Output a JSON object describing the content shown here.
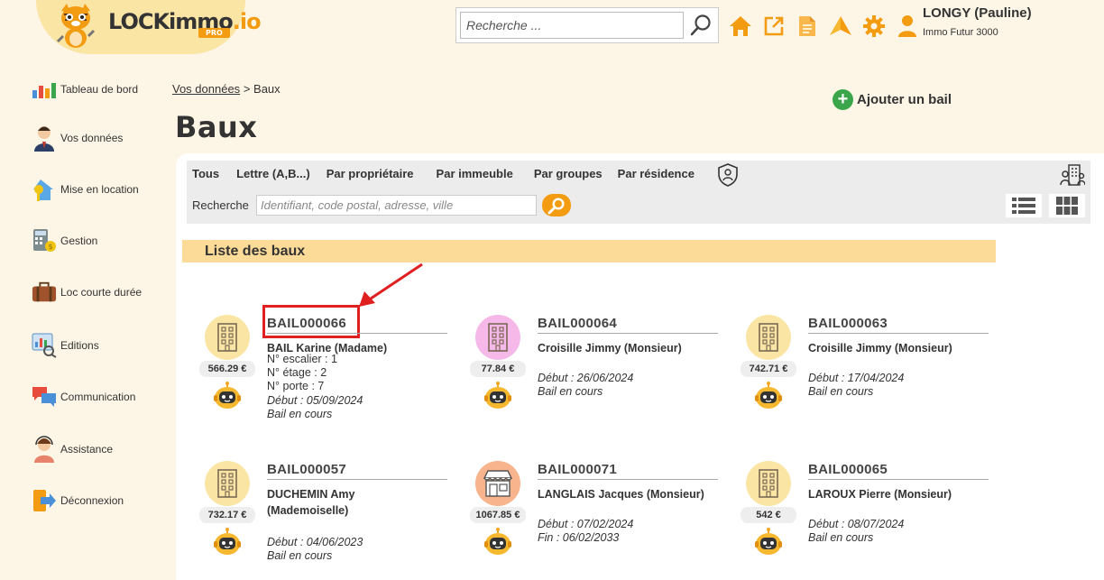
{
  "app": {
    "logo_text": "LOCKimmo",
    "logo_suffix": ".io",
    "logo_badge": "PRO",
    "colors": {
      "accent": "#f39c12",
      "brand_bg": "#fbe5a5",
      "section_header": "#fbdb97",
      "highlight": "#e02020"
    }
  },
  "search": {
    "placeholder": "Recherche ..."
  },
  "user": {
    "name": "LONGY (Pauline)",
    "agency": "Immo Futur 3000"
  },
  "top_icons": [
    "home-icon",
    "external-link-icon",
    "document-icon",
    "paper-plane-icon",
    "settings-icon",
    "user-icon"
  ],
  "sidebar": {
    "items": [
      {
        "label": "Tableau de bord",
        "icon": "dashboard-icon"
      },
      {
        "label": "Vos données",
        "icon": "user-data-icon"
      },
      {
        "label": "Mise en location",
        "icon": "house-key-icon"
      },
      {
        "label": "Gestion",
        "icon": "calculator-icon"
      },
      {
        "label": "Loc courte durée",
        "icon": "suitcase-icon"
      },
      {
        "label": "Editions",
        "icon": "editions-icon"
      },
      {
        "label": "Communication",
        "icon": "chat-icon"
      },
      {
        "label": "Assistance",
        "icon": "support-icon"
      },
      {
        "label": "Déconnexion",
        "icon": "logout-icon"
      }
    ]
  },
  "breadcrumb": {
    "parent": "Vos données",
    "separator": ">",
    "current": "Baux"
  },
  "page": {
    "title": "Baux",
    "add_button": "Ajouter un bail"
  },
  "filters": {
    "tabs": [
      "Tous",
      "Lettre (A,B...)",
      "Par propriétaire",
      "Par immeuble",
      "Par groupes",
      "Par résidence"
    ],
    "search_label": "Recherche",
    "search_placeholder": "Identifiant, code postal, adresse, ville"
  },
  "list": {
    "title": "Liste des baux",
    "leases": [
      {
        "ref": "BAIL000066",
        "tenant": "BAIL Karine (Madame)",
        "price": "566.29 €",
        "details": [
          "N° escalier : 1",
          "N° étage : 2",
          "N° porte : 7"
        ],
        "start": "Début : 05/09/2024",
        "status": "Bail en cours",
        "icon_color": "#fbe5a5",
        "icon": "building-icon"
      },
      {
        "ref": "BAIL000064",
        "tenant": "Croisille Jimmy (Monsieur)",
        "price": "77.84 €",
        "details": [],
        "start": "Début : 26/06/2024",
        "status": "Bail en cours",
        "icon_color": "#f6b8e8",
        "icon": "building-icon"
      },
      {
        "ref": "BAIL000063",
        "tenant": "Croisille Jimmy (Monsieur)",
        "price": "742.71 €",
        "details": [],
        "start": "Début : 17/04/2024",
        "status": "Bail en cours",
        "icon_color": "#fbe5a5",
        "icon": "building-icon"
      },
      {
        "ref": "BAIL000057",
        "tenant": "DUCHEMIN Amy (Mademoiselle)",
        "price": "732.17 €",
        "details": [],
        "start": "Début : 04/06/2023",
        "status": "Bail en cours",
        "icon_color": "#fbe5a5",
        "icon": "building-icon"
      },
      {
        "ref": "BAIL000071",
        "tenant": "LANGLAIS Jacques (Monsieur)",
        "price": "1067.85 €",
        "details": [],
        "start": "Début : 07/02/2024",
        "status": "Fin : 06/02/2033",
        "icon_color": "#f8b48c",
        "icon": "shop-icon"
      },
      {
        "ref": "BAIL000065",
        "tenant": "LAROUX Pierre (Monsieur)",
        "price": "542 €",
        "details": [],
        "start": "Début : 08/07/2024",
        "status": "Bail en cours",
        "icon_color": "#fbe5a5",
        "icon": "building-icon"
      }
    ]
  }
}
